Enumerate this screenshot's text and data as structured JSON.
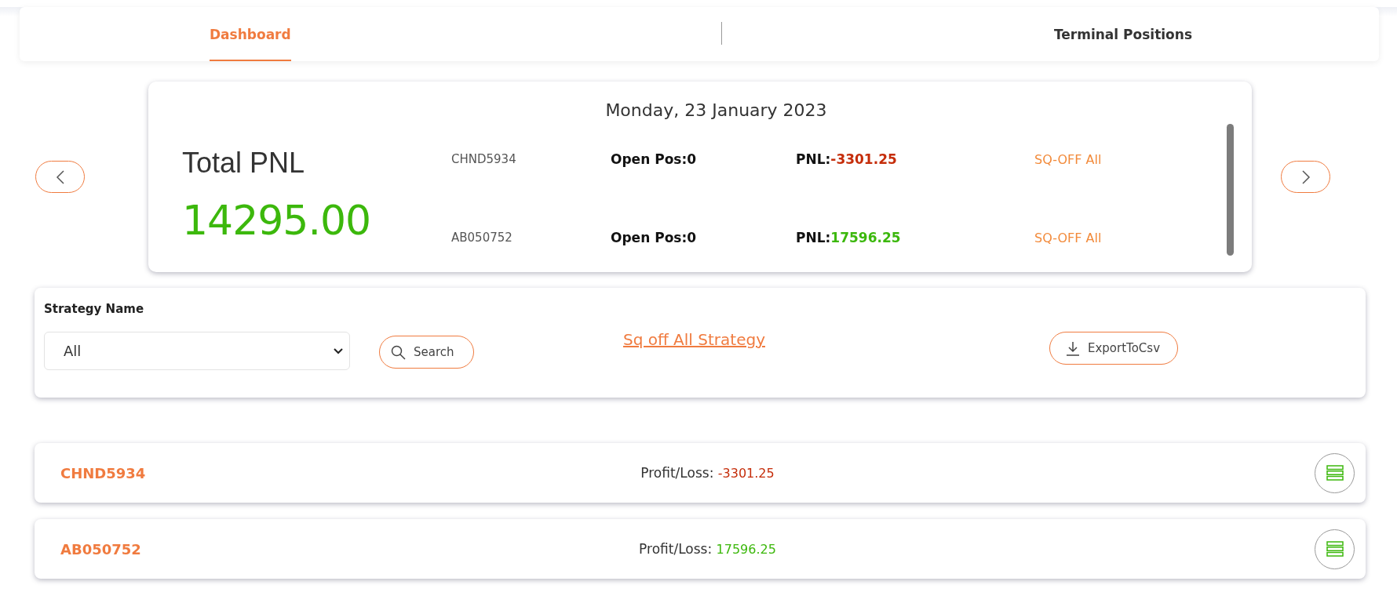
{
  "nav": {
    "tabs": [
      {
        "label": "Dashboard",
        "selected": true
      },
      {
        "label": "Terminal Positions",
        "selected": false
      }
    ]
  },
  "summary": {
    "date": "Monday, 23 January 2023",
    "total_label": "Total PNL",
    "total_value": "14295.00",
    "accounts": [
      {
        "id": "CHND5934",
        "open_pos": "Open Pos:0",
        "pnl_label": "PNL:",
        "pnl_value": "-3301.25",
        "color": "#c52d0a",
        "action": "SQ-OFF All"
      },
      {
        "id": "AB050752",
        "open_pos": "Open Pos:0",
        "pnl_label": "PNL:",
        "pnl_value": "17596.25",
        "color": "#3cb80c",
        "action": "SQ-OFF All"
      }
    ]
  },
  "filter": {
    "label": "Strategy Name",
    "select_value": "All",
    "search_button": "Search",
    "sq_off_link": "Sq off All Strategy",
    "export_button": "ExportToCsv"
  },
  "strategies": [
    {
      "name": "CHND5934",
      "pl_label": "Profit/Loss:",
      "pl_value": "-3301.25",
      "color": "#c52d0a"
    },
    {
      "name": "AB050752",
      "pl_label": "Profit/Loss:",
      "pl_value": "17596.25",
      "color": "#3cb80c"
    }
  ]
}
